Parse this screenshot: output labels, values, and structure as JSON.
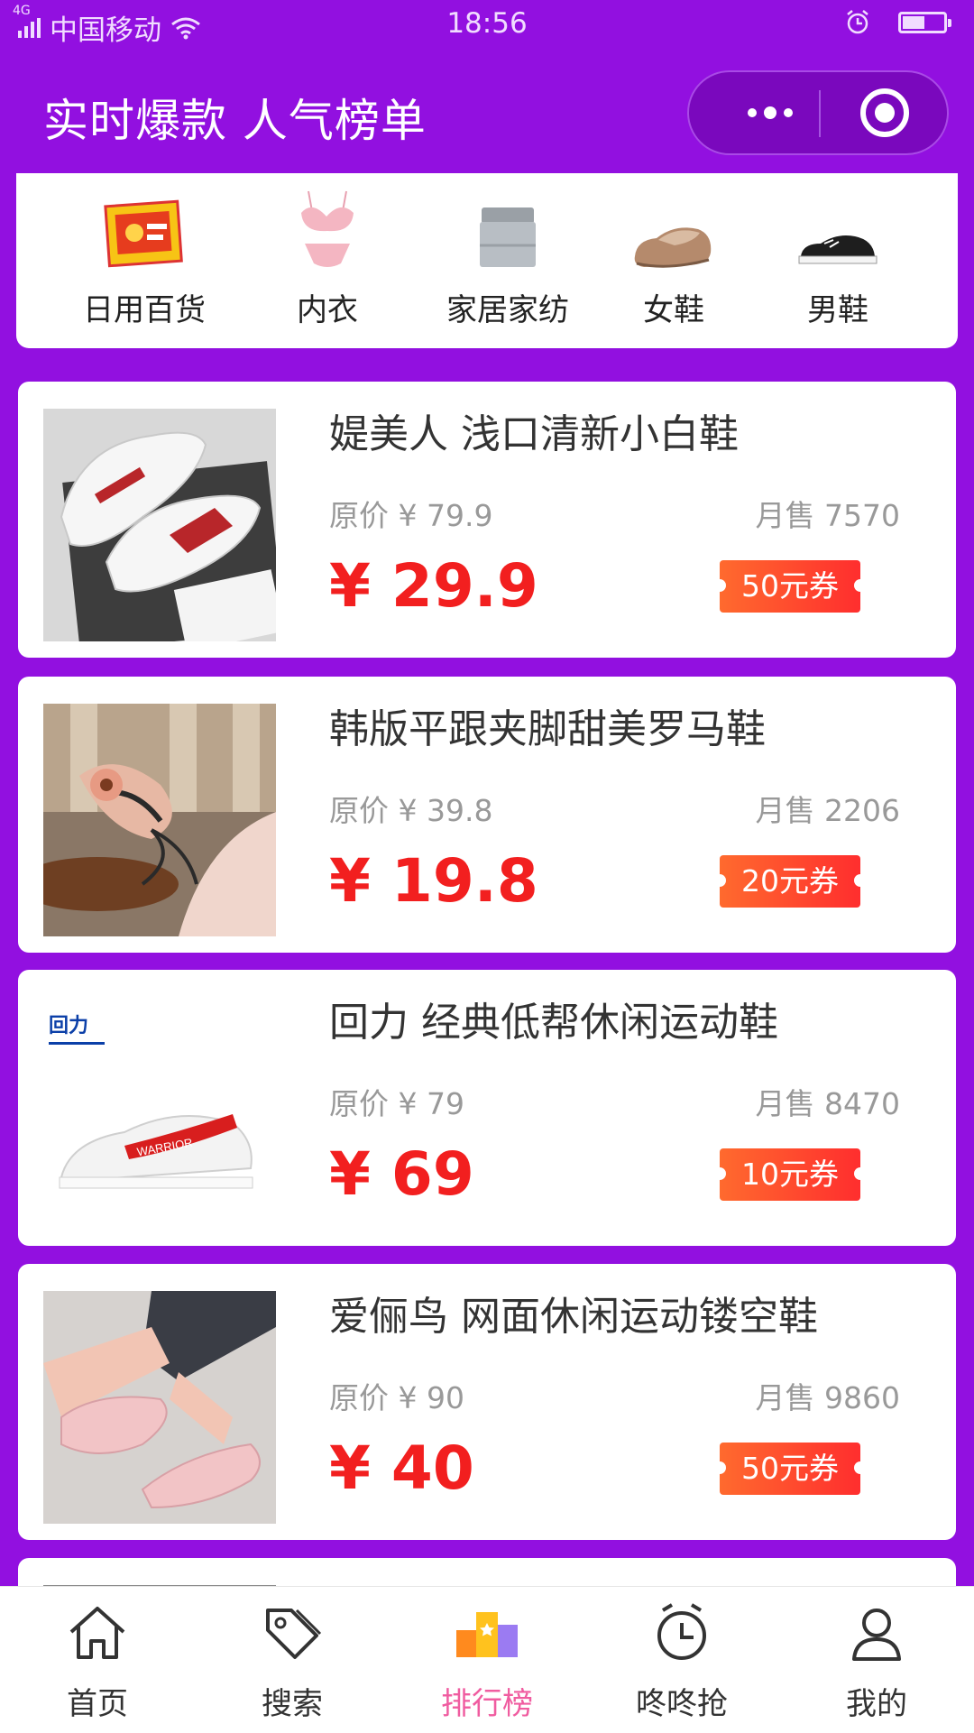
{
  "status_bar": {
    "network": "4G",
    "carrier": "中国移动",
    "time": "18:56"
  },
  "header": {
    "title": "实时爆款 人气榜单"
  },
  "categories": [
    {
      "label": "日用百货",
      "active": false,
      "icon": "hand-warmer-pack-icon"
    },
    {
      "label": "内衣",
      "active": false,
      "icon": "lingerie-icon"
    },
    {
      "label": "家居家纺",
      "active": false,
      "icon": "bedding-icon"
    },
    {
      "label": "女鞋",
      "active": true,
      "icon": "womens-shoe-icon"
    },
    {
      "label": "男鞋",
      "active": false,
      "icon": "mens-sneaker-icon"
    }
  ],
  "products": [
    {
      "name": "媞美人 浅口清新小白鞋",
      "original_price": "原价 ¥ 79.9",
      "monthly_sales": "月售 7570",
      "price": "¥ 29.9",
      "coupon": "50元券"
    },
    {
      "name": "韩版平跟夹脚甜美罗马鞋",
      "original_price": "原价 ¥ 39.8",
      "monthly_sales": "月售 2206",
      "price": "¥ 19.8",
      "coupon": "20元券"
    },
    {
      "name": "回力 经典低帮休闲运动鞋",
      "original_price": "原价 ¥ 79",
      "monthly_sales": "月售 8470",
      "price": "¥ 69",
      "coupon": "10元券",
      "brand_logo": "回力",
      "shoe_text": "WARRIOR"
    },
    {
      "name": "爱俪鸟 网面休闲运动镂空鞋",
      "original_price": "原价 ¥ 90",
      "monthly_sales": "月售 9860",
      "price": "¥ 40",
      "coupon": "50元券"
    }
  ],
  "tabbar": [
    {
      "label": "首页",
      "icon": "home-icon",
      "active": false
    },
    {
      "label": "搜索",
      "icon": "tag-icon",
      "active": false
    },
    {
      "label": "排行榜",
      "icon": "ranking-podium-icon",
      "active": true
    },
    {
      "label": "咚咚抢",
      "icon": "alarm-clock-icon",
      "active": false
    },
    {
      "label": "我的",
      "icon": "user-icon",
      "active": false
    }
  ],
  "colors": {
    "header_bg": "#9210e0",
    "price_red": "#f21f1f",
    "active_pink": "#f05ca0",
    "coupon_gradient": [
      "#ff6a2e",
      "#ff2e2e"
    ]
  }
}
